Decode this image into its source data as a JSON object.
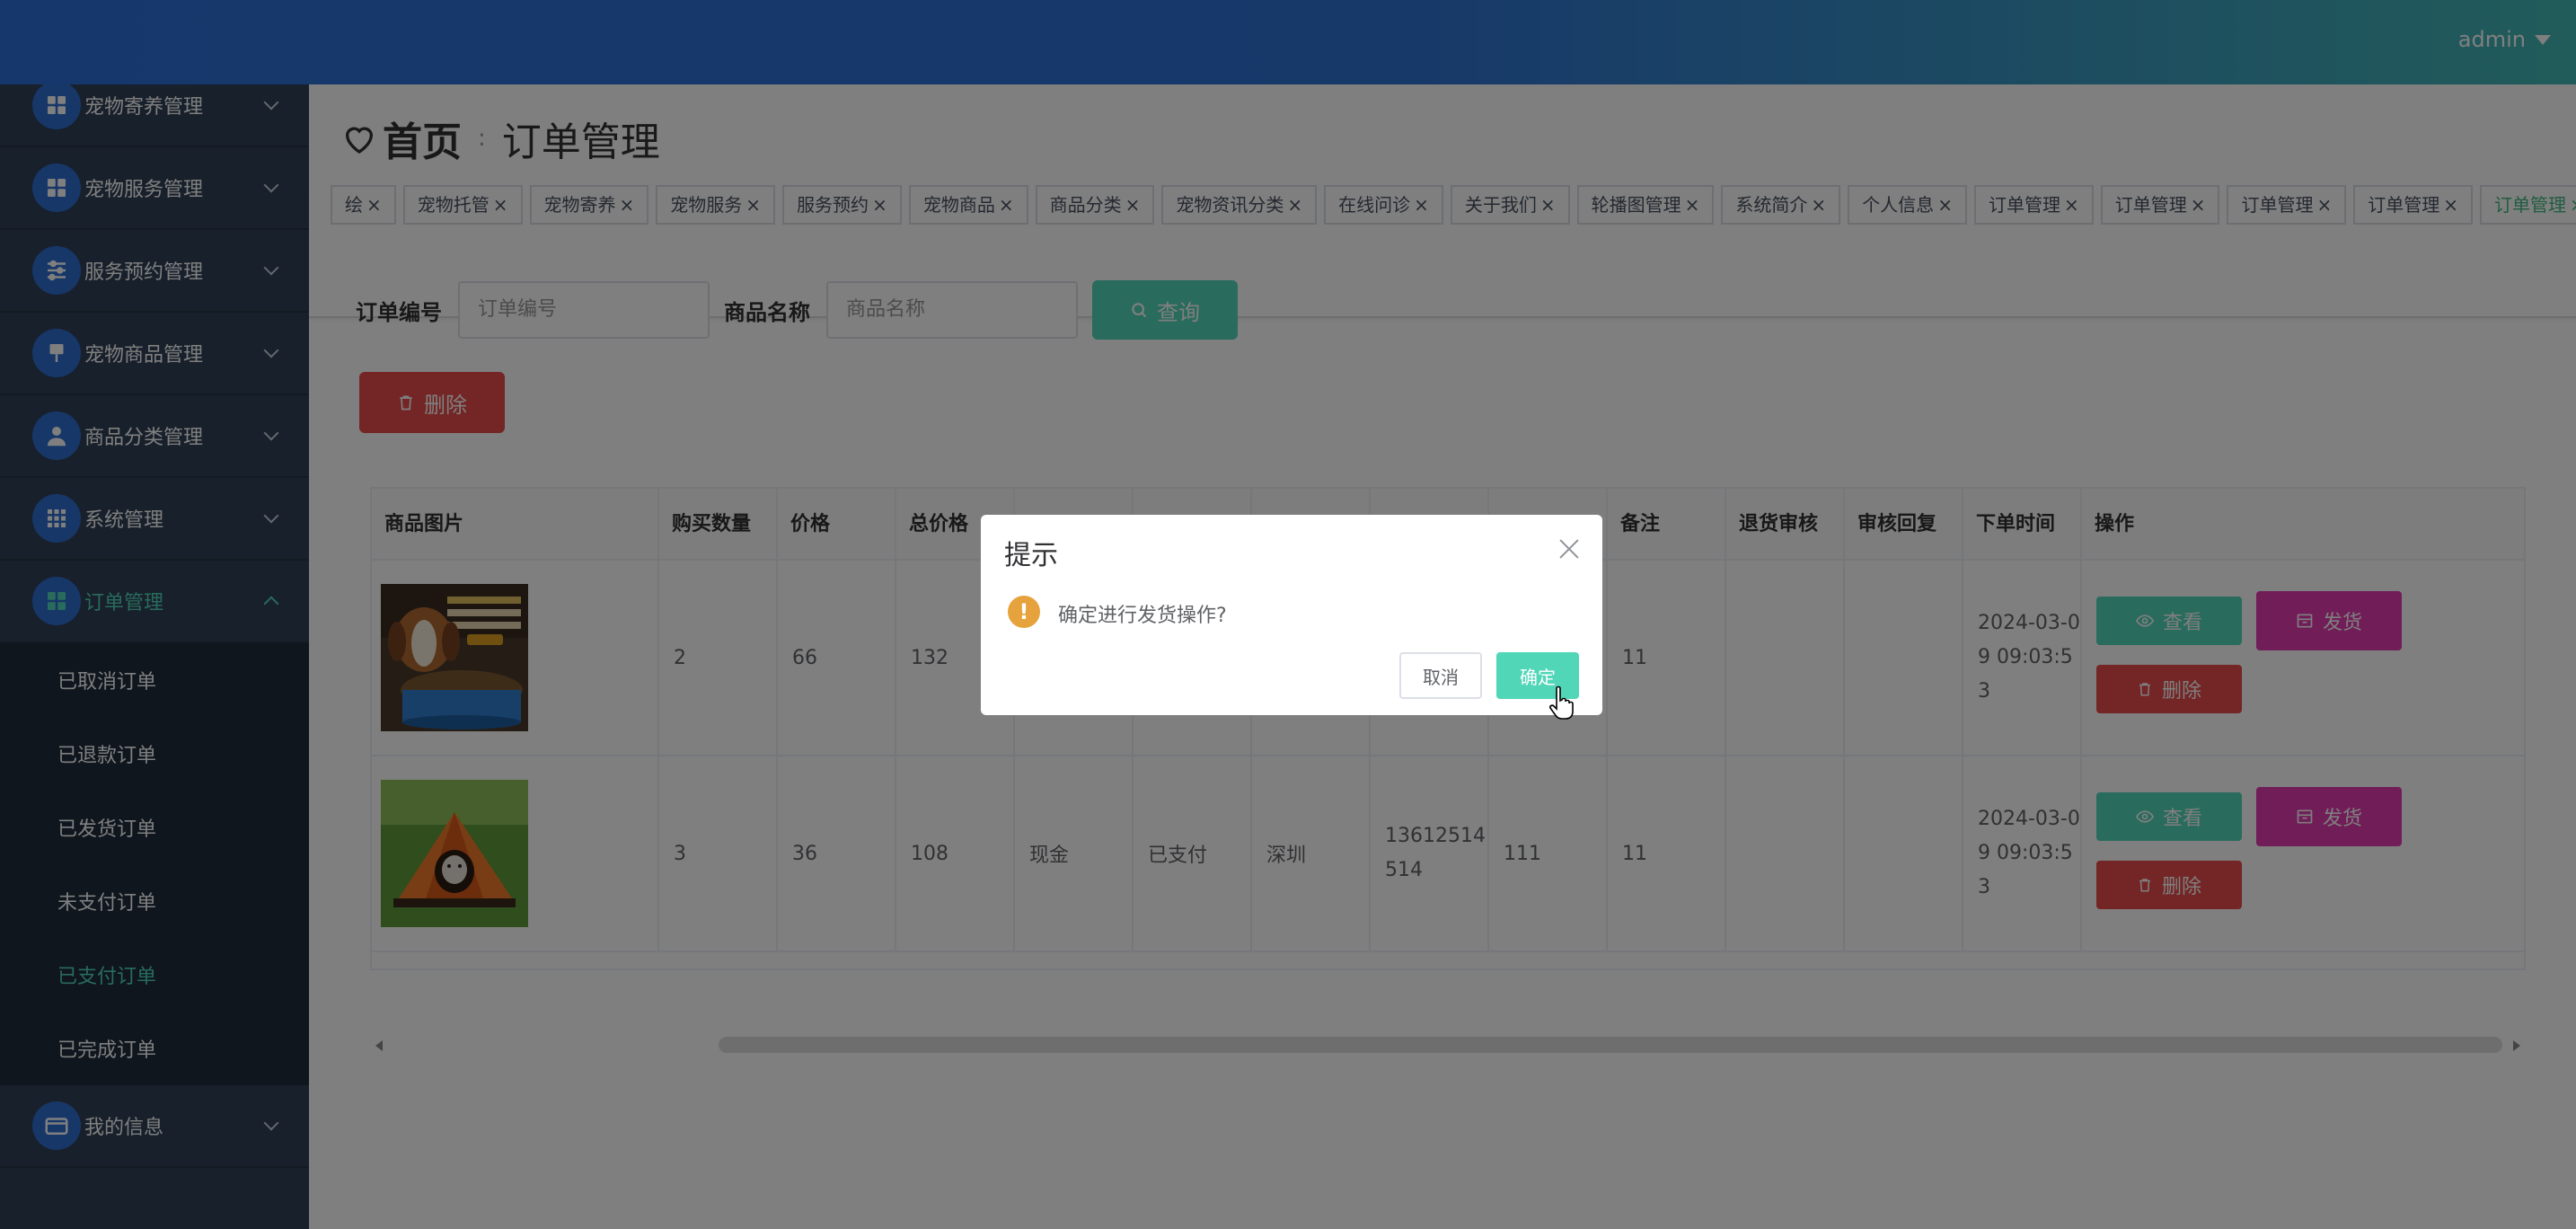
{
  "header": {
    "user": "admin"
  },
  "sidebar": {
    "menus": [
      {
        "label": "宠物寄养管理",
        "icon": "grid-icon"
      },
      {
        "label": "宠物服务管理",
        "icon": "grid-icon"
      },
      {
        "label": "服务预约管理",
        "icon": "sliders-icon"
      },
      {
        "label": "宠物商品管理",
        "icon": "signpost-icon"
      },
      {
        "label": "商品分类管理",
        "icon": "user-icon"
      },
      {
        "label": "系统管理",
        "icon": "apps-icon"
      },
      {
        "label": "订单管理",
        "icon": "grid-icon"
      }
    ],
    "submenu": [
      "已取消订单",
      "已退款订单",
      "已发货订单",
      "未支付订单",
      "已支付订单",
      "已完成订单"
    ],
    "active_submenu": "已支付订单",
    "last_menu": {
      "label": "我的信息",
      "icon": "card-icon"
    }
  },
  "breadcrumb": {
    "home": "首页",
    "sep": ":",
    "current": "订单管理"
  },
  "tags": [
    "绘",
    "宠物托管",
    "宠物寄养",
    "宠物服务",
    "服务预约",
    "宠物商品",
    "商品分类",
    "宠物资讯分类",
    "在线问诊",
    "关于我们",
    "轮播图管理",
    "系统简介",
    "个人信息",
    "订单管理",
    "订单管理",
    "订单管理",
    "订单管理",
    "订单管理"
  ],
  "tag_close": "×",
  "filters": {
    "order_no_label": "订单编号",
    "order_no_placeholder": "订单编号",
    "product_label": "商品名称",
    "product_placeholder": "商品名称",
    "query_label": "查询"
  },
  "delete_label": "删除",
  "table": {
    "headers": [
      "商品图片",
      "购买数量",
      "价格",
      "总价格",
      "",
      "",
      "",
      "",
      "",
      "备注",
      "退货审核",
      "审核回复",
      "下单时间",
      "操作"
    ],
    "rows": [
      {
        "qty": "2",
        "price": "66",
        "total": "132",
        "pay": "",
        "status": "",
        "addr": "",
        "phone": "",
        "extra": "",
        "note": "11",
        "return": "",
        "reply": "",
        "time": "2024-03-09 09:03:53"
      },
      {
        "qty": "3",
        "price": "36",
        "total": "108",
        "pay": "现金",
        "status": "已支付",
        "addr": "深圳",
        "phone": "13612514514",
        "extra": "111",
        "note": "11",
        "return": "",
        "reply": "",
        "time": "2024-03-09 09:03:53"
      }
    ],
    "ops": {
      "view": "查看",
      "ship": "发货",
      "delete": "删除"
    }
  },
  "dialog": {
    "title": "提示",
    "message": "确定进行发货操作?",
    "cancel": "取消",
    "confirm": "确定"
  }
}
